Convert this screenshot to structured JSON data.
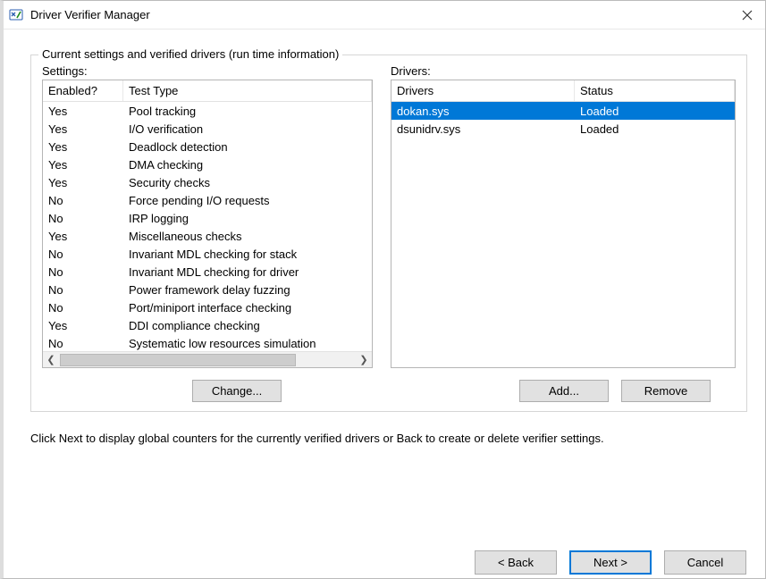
{
  "window": {
    "title": "Driver Verifier Manager"
  },
  "groupbox": {
    "legend": "Current settings and verified drivers (run time information)"
  },
  "settings_panel": {
    "label": "Settings:",
    "columns": {
      "enabled": "Enabled?",
      "type": "Test Type"
    },
    "rows": [
      {
        "enabled": "Yes",
        "type": "Pool tracking"
      },
      {
        "enabled": "Yes",
        "type": "I/O verification"
      },
      {
        "enabled": "Yes",
        "type": "Deadlock detection"
      },
      {
        "enabled": "Yes",
        "type": "DMA checking"
      },
      {
        "enabled": "Yes",
        "type": "Security checks"
      },
      {
        "enabled": "No",
        "type": "Force pending I/O requests"
      },
      {
        "enabled": "No",
        "type": "IRP logging"
      },
      {
        "enabled": "Yes",
        "type": "Miscellaneous checks"
      },
      {
        "enabled": "No",
        "type": "Invariant MDL checking for stack"
      },
      {
        "enabled": "No",
        "type": "Invariant MDL checking for driver"
      },
      {
        "enabled": "No",
        "type": "Power framework delay fuzzing"
      },
      {
        "enabled": "No",
        "type": "Port/miniport interface checking"
      },
      {
        "enabled": "Yes",
        "type": "DDI compliance checking"
      },
      {
        "enabled": "No",
        "type": "Systematic low resources simulation"
      }
    ],
    "change_button": "Change..."
  },
  "drivers_panel": {
    "label": "Drivers:",
    "columns": {
      "driver": "Drivers",
      "status": "Status"
    },
    "rows": [
      {
        "driver": "dokan.sys",
        "status": "Loaded",
        "selected": true
      },
      {
        "driver": "dsunidrv.sys",
        "status": "Loaded",
        "selected": false
      }
    ],
    "add_button": "Add...",
    "remove_button": "Remove"
  },
  "hint_text": "Click Next to display global counters for the currently verified drivers or Back to create or delete verifier settings.",
  "wizard": {
    "back": "< Back",
    "next": "Next >",
    "cancel": "Cancel"
  }
}
